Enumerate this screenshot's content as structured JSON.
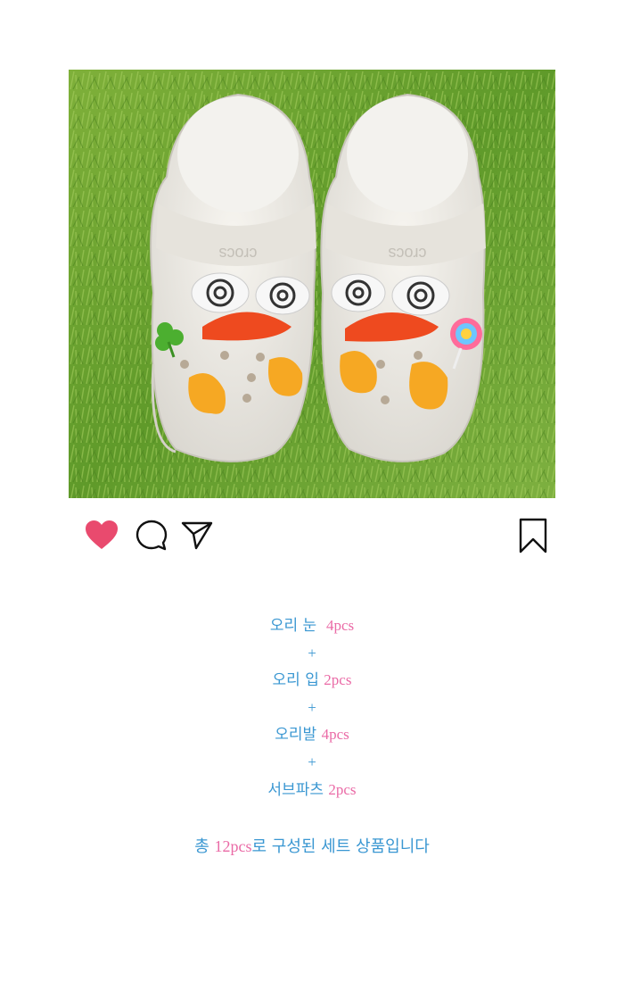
{
  "post": {
    "image": {
      "description": ""
    },
    "actions": {
      "like_icon": "heart-icon",
      "comment_icon": "comment-icon",
      "share_icon": "send-icon",
      "save_icon": "bookmark-icon",
      "like_color": "#e94a6e"
    },
    "items": [
      {
        "name": "오리 눈",
        "qty": "4pcs"
      },
      {
        "name": "+"
      },
      {
        "name": "오리 입",
        "qty": "2pcs"
      },
      {
        "name": "+"
      },
      {
        "name": "오리발",
        "qty": "4pcs"
      },
      {
        "name": "+"
      },
      {
        "name": "서브파츠",
        "qty": "2pcs"
      }
    ],
    "summary": {
      "prefix": "총 ",
      "qty": "12pcs",
      "suffix": "로 구성된 세트 상품입니다"
    }
  },
  "colors": {
    "text_blue": "#3a97d2",
    "qty_pink": "#ea6aa6"
  }
}
